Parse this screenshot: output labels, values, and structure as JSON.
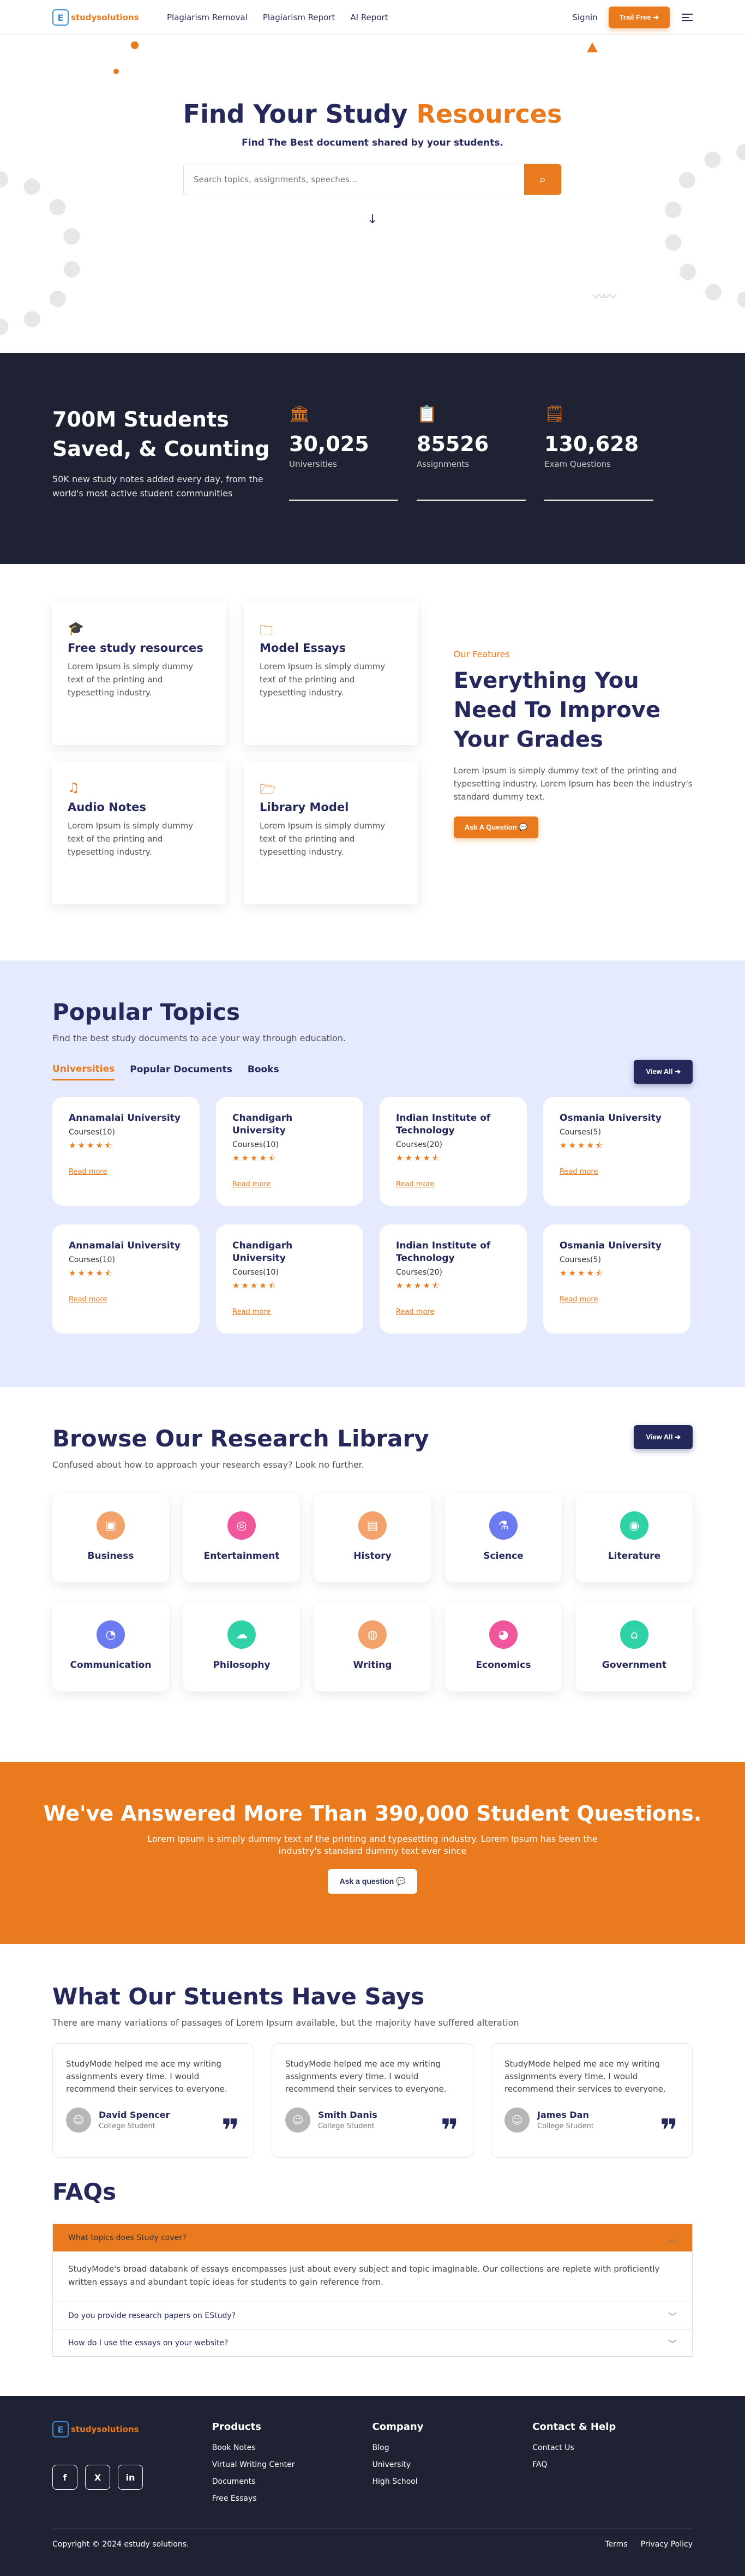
{
  "header": {
    "logo_text": "studysolutions",
    "logo_prefix": "E",
    "nav": [
      "Plagiarism Removal",
      "Plagiarism Report",
      "AI Report"
    ],
    "signin": "Signin",
    "trial_button": "Trail Free ➔"
  },
  "hero": {
    "title_a": "Find Your Study ",
    "title_b": "Resources",
    "subtitle": "Find The Best document shared by your students.",
    "search_placeholder": "Search topics, assignments, speeches..."
  },
  "stats": {
    "title": "700M Students Saved, & Counting",
    "text": "50K new study notes added every day, from the world's most active student communities",
    "items": [
      {
        "icon": "bank-icon",
        "value": "30,025",
        "label": "Universities"
      },
      {
        "icon": "document-icon",
        "value": "85526",
        "label": "Assignments"
      },
      {
        "icon": "notes-icon",
        "value": "130,628",
        "label": "Exam Questions"
      }
    ]
  },
  "features": {
    "cards": [
      {
        "icon": "graduation-cap-icon",
        "title": "Free study resources",
        "text": "Lorem Ipsum is simply dummy text of the printing and typesetting industry."
      },
      {
        "icon": "folder-icon",
        "title": "Model Essays",
        "text": "Lorem Ipsum is simply dummy text of the printing and typesetting industry."
      },
      {
        "icon": "audio-file-icon",
        "title": "Audio Notes",
        "text": "Lorem Ipsum is simply dummy text of the printing and typesetting industry."
      },
      {
        "icon": "library-folder-icon",
        "title": "Library Model",
        "text": "Lorem Ipsum is simply dummy text of the printing and typesetting industry."
      }
    ],
    "kicker": "Our Features",
    "title": "Everything You Need To Improve Your Grades",
    "text": "Lorem Ipsum is simply dummy text of the printing and typesetting industry. Lorem Ipsum has been the industry's standard dummy text.",
    "button": "Ask A Question 💬"
  },
  "topics": {
    "title": "Popular Topics",
    "subtitle": "Find the best study documents to ace your way through education.",
    "tabs": [
      "Universities",
      "Popular Documents",
      "Books"
    ],
    "view_all": "View All ➔",
    "read_more": "Read more",
    "cards": [
      {
        "name": "Annamalai University",
        "courses": "Courses(10)"
      },
      {
        "name": "Chandigarh University",
        "courses": "Courses(10)"
      },
      {
        "name": "Indian Institute of Technology",
        "courses": "Courses(20)"
      },
      {
        "name": "Osmania University",
        "courses": "Courses(5)"
      },
      {
        "name": "Annamalai University",
        "courses": "Courses(10)"
      },
      {
        "name": "Chandigarh University",
        "courses": "Courses(10)"
      },
      {
        "name": "Indian Institute of Technology",
        "courses": "Courses(20)"
      },
      {
        "name": "Osmania University",
        "courses": "Courses(5)"
      }
    ],
    "rating_stars": 4.5
  },
  "library": {
    "title": "Browse Our Research Library",
    "subtitle": "Confused about how to approach your research essay? Look no further.",
    "view_all": "View All ➔",
    "items": [
      {
        "name": "Business",
        "color": "#f4a26b",
        "glyph": "▣"
      },
      {
        "name": "Entertainment",
        "color": "#f0569b",
        "glyph": "◎"
      },
      {
        "name": "History",
        "color": "#f4a26b",
        "glyph": "▤"
      },
      {
        "name": "Science",
        "color": "#6c7bf0",
        "glyph": "⚗"
      },
      {
        "name": "Literature",
        "color": "#2fd1a7",
        "glyph": "◉"
      },
      {
        "name": "Communication",
        "color": "#6c7bf0",
        "glyph": "◔"
      },
      {
        "name": "Philosophy",
        "color": "#2fd1a7",
        "glyph": "☁"
      },
      {
        "name": "Writing",
        "color": "#f4a26b",
        "glyph": "◍"
      },
      {
        "name": "Economics",
        "color": "#f0569b",
        "glyph": "◕"
      },
      {
        "name": "Government",
        "color": "#2fd1a7",
        "glyph": "⌂"
      }
    ]
  },
  "band": {
    "title": "We've Answered More Than 390,000 Student Questions.",
    "text": "Lorem Ipsum is simply dummy text of the printing and typesetting industry. Lorem Ipsum has been the industry's standard dummy text ever since",
    "button": "Ask a question 💬"
  },
  "testimonials": {
    "title": "What Our Stuents Have Says",
    "subtitle": "There are many variations of passages of Lorem Ipsum available, but the majority have suffered alteration",
    "items": [
      {
        "text": "StudyMode helped me ace my writing assignments every time. I would recommend their services to everyone.",
        "name": "David Spencer",
        "role": "College Student"
      },
      {
        "text": "StudyMode helped me ace my writing assignments every time. I would recommend their services to everyone.",
        "name": "Smith Danis",
        "role": "College Student"
      },
      {
        "text": "StudyMode helped me ace my writing assignments every time. I would recommend their services to everyone.",
        "name": "James Dan",
        "role": "College Student"
      }
    ]
  },
  "faq": {
    "title": "FAQs",
    "items": [
      {
        "q": "What topics does Study cover?",
        "a": "StudyMode's broad databank of essays encompasses just about every subject and topic imaginable. Our collections are replete with proficiently written essays and abundant topic ideas for students to gain reference from."
      },
      {
        "q": "Do you provide research papers on EStudy?"
      },
      {
        "q": "How do I use the essays on your website?"
      }
    ]
  },
  "footer": {
    "logo_text": "studysolutions",
    "social": [
      "f",
      "X",
      "in"
    ],
    "columns": [
      {
        "title": "Products",
        "links": [
          "Book Notes",
          "Virtual Writing Center",
          "Documents",
          "Free Essays"
        ]
      },
      {
        "title": "Company",
        "links": [
          "Blog",
          "University",
          "High School"
        ]
      },
      {
        "title": "Contact & Help",
        "links": [
          "Contact Us",
          "FAQ"
        ]
      }
    ],
    "copyright": "Copyright © 2024 estudy solutions.",
    "bottom_links": [
      "Terms",
      "Privacy Policy"
    ]
  },
  "colors": {
    "accent": "#ea7a1e",
    "navy": "#24285b",
    "dark": "#1f2233",
    "lavender": "#e6eaff"
  }
}
